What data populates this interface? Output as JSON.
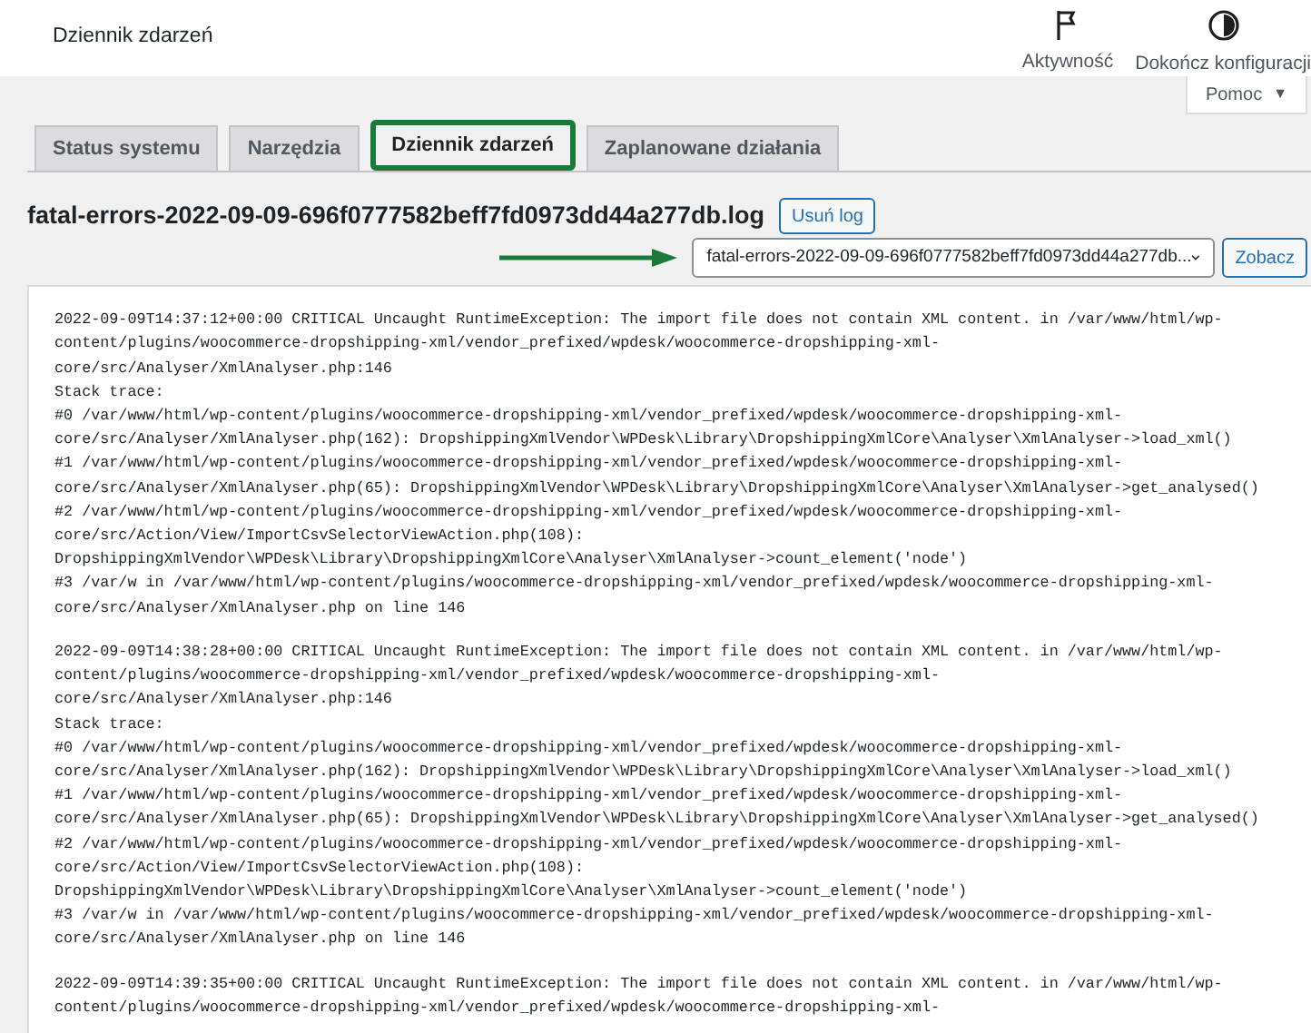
{
  "header": {
    "title": "Dziennik zdarzeń",
    "actions": [
      {
        "kind": "flag",
        "label": "Aktywność"
      },
      {
        "kind": "progress",
        "label": "Dokończ konfiguracji"
      }
    ]
  },
  "help_button": {
    "label": "Pomoc",
    "symbol": "▼"
  },
  "tabs": [
    {
      "label": "Status systemu",
      "selected": false
    },
    {
      "label": "Narzędzia",
      "selected": false
    },
    {
      "label": "Dziennik zdarzeń",
      "selected": true
    },
    {
      "label": "Zaplanowane działania",
      "selected": false
    }
  ],
  "log_title": "fatal-errors-2022-09-09-696f0777582beff7fd0973dd44a277db.log",
  "delete_button": "Usuń log",
  "log_select": {
    "value": "fatal-errors-2022-09-09-696f0777582beff7fd0973dd44a277db..."
  },
  "view_button": "Zobacz",
  "log_entries": [
    {
      "lines": [
        "2022-09-09T14:37:12+00:00 CRITICAL Uncaught RuntimeException: The import file does not contain XML content. in /var/www/html/wp-",
        "content/plugins/woocommerce-dropshipping-xml/vendor_prefixed/wpdesk/woocommerce-dropshipping-xml-",
        "core/src/Analyser/XmlAnalyser.php:146",
        "Stack trace:",
        "#0 /var/www/html/wp-content/plugins/woocommerce-dropshipping-xml/vendor_prefixed/wpdesk/woocommerce-dropshipping-xml-",
        "core/src/Analyser/XmlAnalyser.php(162): DropshippingXmlVendor\\WPDesk\\Library\\DropshippingXmlCore\\Analyser\\XmlAnalyser->load_xml()",
        "#1 /var/www/html/wp-content/plugins/woocommerce-dropshipping-xml/vendor_prefixed/wpdesk/woocommerce-dropshipping-xml-",
        "core/src/Analyser/XmlAnalyser.php(65): DropshippingXmlVendor\\WPDesk\\Library\\DropshippingXmlCore\\Analyser\\XmlAnalyser->get_analysed()",
        "#2 /var/www/html/wp-content/plugins/woocommerce-dropshipping-xml/vendor_prefixed/wpdesk/woocommerce-dropshipping-xml-",
        "core/src/Action/View/ImportCsvSelectorViewAction.php(108):",
        "DropshippingXmlVendor\\WPDesk\\Library\\DropshippingXmlCore\\Analyser\\XmlAnalyser->count_element('node')",
        "#3 /var/w in /var/www/html/wp-content/plugins/woocommerce-dropshipping-xml/vendor_prefixed/wpdesk/woocommerce-dropshipping-xml-",
        "core/src/Analyser/XmlAnalyser.php on line 146"
      ]
    },
    {
      "lines": [
        "2022-09-09T14:38:28+00:00 CRITICAL Uncaught RuntimeException: The import file does not contain XML content. in /var/www/html/wp-",
        "content/plugins/woocommerce-dropshipping-xml/vendor_prefixed/wpdesk/woocommerce-dropshipping-xml-",
        "core/src/Analyser/XmlAnalyser.php:146",
        "Stack trace:",
        "#0 /var/www/html/wp-content/plugins/woocommerce-dropshipping-xml/vendor_prefixed/wpdesk/woocommerce-dropshipping-xml-",
        "core/src/Analyser/XmlAnalyser.php(162): DropshippingXmlVendor\\WPDesk\\Library\\DropshippingXmlCore\\Analyser\\XmlAnalyser->load_xml()",
        "#1 /var/www/html/wp-content/plugins/woocommerce-dropshipping-xml/vendor_prefixed/wpdesk/woocommerce-dropshipping-xml-",
        "core/src/Analyser/XmlAnalyser.php(65): DropshippingXmlVendor\\WPDesk\\Library\\DropshippingXmlCore\\Analyser\\XmlAnalyser->get_analysed()",
        "#2 /var/www/html/wp-content/plugins/woocommerce-dropshipping-xml/vendor_prefixed/wpdesk/woocommerce-dropshipping-xml-",
        "core/src/Action/View/ImportCsvSelectorViewAction.php(108):",
        "DropshippingXmlVendor\\WPDesk\\Library\\DropshippingXmlCore\\Analyser\\XmlAnalyser->count_element('node')",
        "#3 /var/w in /var/www/html/wp-content/plugins/woocommerce-dropshipping-xml/vendor_prefixed/wpdesk/woocommerce-dropshipping-xml-",
        "core/src/Analyser/XmlAnalyser.php on line 146"
      ]
    },
    {
      "lines": [
        "2022-09-09T14:39:35+00:00 CRITICAL Uncaught RuntimeException: The import file does not contain XML content. in /var/www/html/wp-",
        "content/plugins/woocommerce-dropshipping-xml/vendor_prefixed/wpdesk/woocommerce-dropshipping-xml-"
      ]
    }
  ]
}
